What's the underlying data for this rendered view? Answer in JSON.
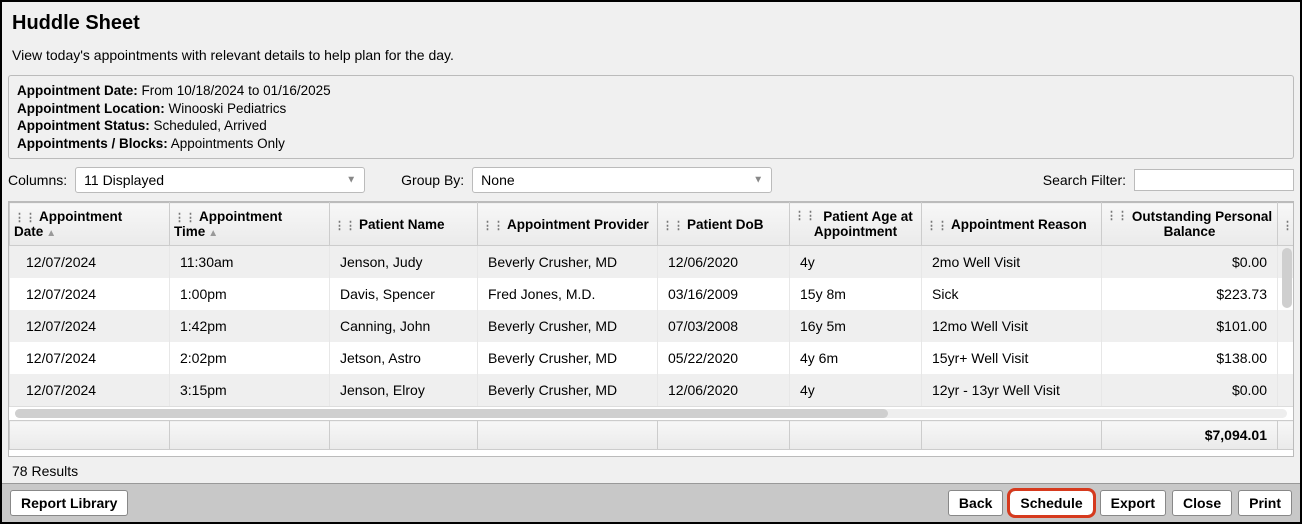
{
  "header": {
    "title": "Huddle Sheet",
    "subtitle": "View today's appointments with relevant details to help plan for the day."
  },
  "criteria": {
    "date_label": "Appointment Date:",
    "date_value": " From 10/18/2024 to 01/16/2025",
    "location_label": "Appointment Location:",
    "location_value": " Winooski Pediatrics",
    "status_label": "Appointment Status:",
    "status_value": " Scheduled, Arrived",
    "blocks_label": "Appointments / Blocks:",
    "blocks_value": " Appointments Only"
  },
  "controls": {
    "columns_label": "Columns:",
    "columns_value": "11 Displayed",
    "groupby_label": "Group By:",
    "groupby_value": "None",
    "search_label": "Search Filter:",
    "search_placeholder": ""
  },
  "table": {
    "headers": {
      "date": "Appointment Date",
      "time": "Appointment Time",
      "name": "Patient Name",
      "provider": "Appointment Provider",
      "dob": "Patient DoB",
      "age": "Patient Age at Appointment",
      "reason": "Appointment Reason",
      "balance": "Outstanding Personal Balance"
    },
    "rows": [
      {
        "date": "12/07/2024",
        "time": "11:30am",
        "name": "Jenson, Judy",
        "provider": "Beverly Crusher, MD",
        "dob": "12/06/2020",
        "age": "4y",
        "reason": "2mo Well Visit",
        "balance": "$0.00"
      },
      {
        "date": "12/07/2024",
        "time": "1:00pm",
        "name": "Davis, Spencer",
        "provider": "Fred Jones, M.D.",
        "dob": "03/16/2009",
        "age": "15y 8m",
        "reason": "Sick",
        "balance": "$223.73"
      },
      {
        "date": "12/07/2024",
        "time": "1:42pm",
        "name": "Canning, John",
        "provider": "Beverly Crusher, MD",
        "dob": "07/03/2008",
        "age": "16y 5m",
        "reason": "12mo Well Visit",
        "balance": "$101.00"
      },
      {
        "date": "12/07/2024",
        "time": "2:02pm",
        "name": "Jetson, Astro",
        "provider": "Beverly Crusher, MD",
        "dob": "05/22/2020",
        "age": "4y 6m",
        "reason": "15yr+ Well Visit",
        "balance": "$138.00"
      },
      {
        "date": "12/07/2024",
        "time": "3:15pm",
        "name": "Jenson, Elroy",
        "provider": "Beverly Crusher, MD",
        "dob": "12/06/2020",
        "age": "4y",
        "reason": "12yr - 13yr Well Visit",
        "balance": "$0.00"
      }
    ],
    "footer_total": "$7,094.01"
  },
  "results": "78 Results",
  "footer_buttons": {
    "report_library": "Report Library",
    "back": "Back",
    "schedule": "Schedule",
    "export": "Export",
    "close": "Close",
    "print": "Print"
  }
}
